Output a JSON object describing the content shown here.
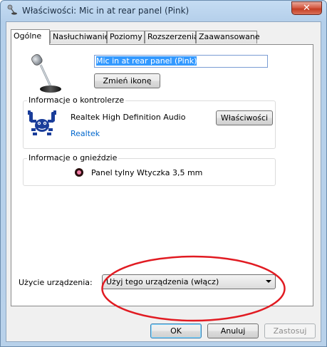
{
  "window": {
    "title": "Właściwości: Mic in at rear panel (Pink)",
    "close_glyph": "✕",
    "title_icon": "speaker-microphone-icon"
  },
  "tabs": [
    {
      "label": "Ogólne",
      "active": true
    },
    {
      "label": "Nasłuchiwanie",
      "active": false
    },
    {
      "label": "Poziomy",
      "active": false
    },
    {
      "label": "Rozszerzenia",
      "active": false
    },
    {
      "label": "Zaawansowane",
      "active": false
    }
  ],
  "general": {
    "device_icon": "microphone-icon",
    "device_name": "Mic in at rear panel (Pink)",
    "change_icon_label": "Zmień ikonę"
  },
  "controller": {
    "group_title": "Informacje o kontrolerze",
    "name": "Realtek High Definition Audio",
    "vendor_link": "Realtek",
    "properties_label": "Właściwości",
    "logo_icon": "realtek-crab-logo"
  },
  "jack": {
    "group_title": "Informacje o gnieździe",
    "label": "Panel tylny Wtyczka 3,5 mm",
    "color": "#f07ba5"
  },
  "usage": {
    "label": "Użycie urządzenia:",
    "selected": "Użyj tego urządzenia (włącz)"
  },
  "footer": {
    "ok_label": "OK",
    "cancel_label": "Anuluj",
    "apply_label": "Zastosuj"
  },
  "colors": {
    "accent_link": "#0066cc",
    "highlight": "#3399ff",
    "annotation_ellipse": "#e11b22"
  }
}
